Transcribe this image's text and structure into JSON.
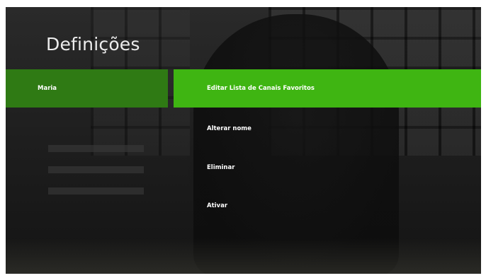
{
  "page": {
    "title": "Definições"
  },
  "profiles": [
    {
      "label": "Maria",
      "selected": true
    }
  ],
  "menu": {
    "items": [
      {
        "label": "Editar Lista de Canais Favoritos",
        "focused": true
      },
      {
        "label": "Alterar nome",
        "focused": false
      },
      {
        "label": "Eliminar",
        "focused": false
      },
      {
        "label": "Ativar",
        "focused": false
      }
    ]
  },
  "colors": {
    "focus_green": "#3fb512",
    "selected_green": "#2f7a14",
    "text": "#ffffff"
  }
}
